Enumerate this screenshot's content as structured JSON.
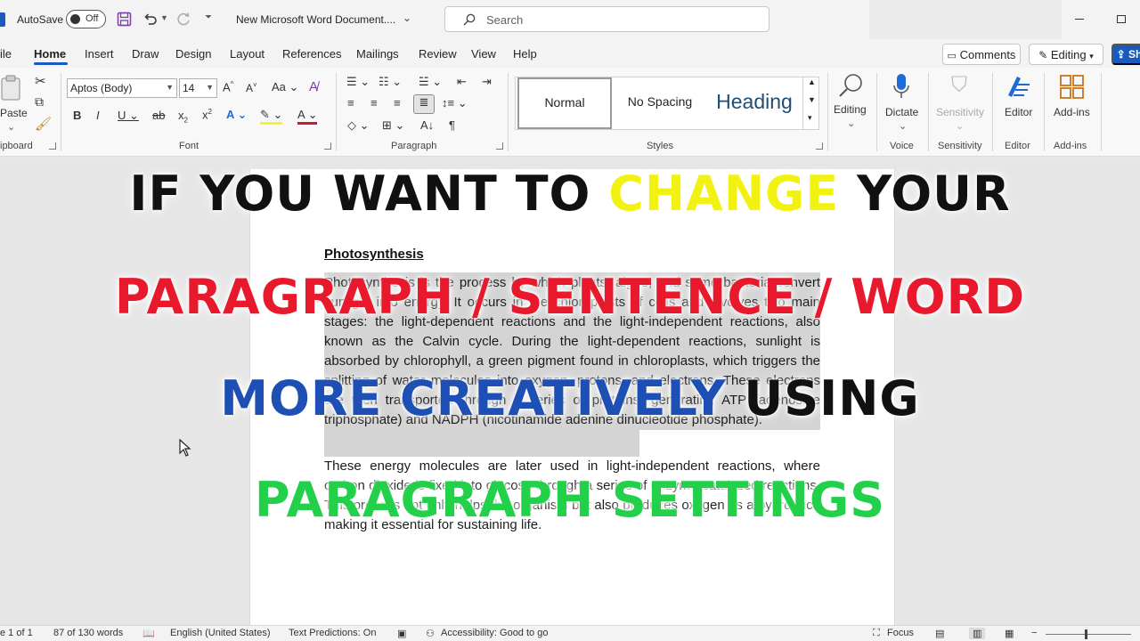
{
  "titlebar": {
    "autosave_label": "AutoSave",
    "autosave_state": "Off",
    "doc_name": "New Microsoft Word Document....",
    "search_placeholder": "Search"
  },
  "tabs": [
    {
      "label": "File",
      "display": "ile"
    },
    {
      "label": "Home",
      "active": true
    },
    {
      "label": "Insert"
    },
    {
      "label": "Draw"
    },
    {
      "label": "Design"
    },
    {
      "label": "Layout"
    },
    {
      "label": "References"
    },
    {
      "label": "Mailings"
    },
    {
      "label": "Review"
    },
    {
      "label": "View"
    },
    {
      "label": "Help"
    }
  ],
  "top_buttons": {
    "comments": "Comments",
    "editing": "Editing",
    "share": "Sh"
  },
  "ribbon": {
    "clipboard": {
      "paste": "Paste",
      "group_label": "ipboard"
    },
    "font": {
      "name": "Aptos (Body)",
      "size": "14",
      "group_label": "Font"
    },
    "paragraph": {
      "group_label": "Paragraph"
    },
    "styles": {
      "items": [
        "Normal",
        "No Spacing",
        "Heading"
      ],
      "group_label": "Styles"
    },
    "editing": {
      "label": "Editing"
    },
    "voice": {
      "dictate": "Dictate",
      "group_label": "Voice"
    },
    "sensitivity": {
      "label": "Sensitivity",
      "group_label": "Sensitivity"
    },
    "editor": {
      "label": "Editor",
      "group_label": "Editor"
    },
    "addins": {
      "label": "Add-ins",
      "group_label": "Add-ins"
    }
  },
  "document": {
    "title": "Photosynthesis",
    "paragraph1": "Photosynthesis is the process by which plants, algae, and some bacteria convert sunlight into energy. It occurs in the chloroplasts of cells and involves two main stages: the light-dependent reactions and the light-independent reactions, also known as the Calvin cycle. During the light-dependent reactions, sunlight is absorbed by chlorophyll, a green pigment found in chloroplasts, which triggers the splitting of water molecules into oxygen, protons, and electrons. These electrons are then transported through a series of proteins, generating ATP (adenosine triphosphate) and NADPH (nicotinamide adenine dinucleotide phosphate).",
    "paragraph2": "These energy molecules are later used in light-independent reactions, where carbon dioxide is fixed into glucose through a series of enzyme-catalyzed reactions. This process not only helps the organism but also produces oxygen as a byproduct, making it essential for sustaining life."
  },
  "overlay": {
    "line1": [
      {
        "text": "IF YOU WANT TO ",
        "color": "black"
      },
      {
        "text": "CHANGE",
        "color": "yellow"
      },
      {
        "text": " YOUR",
        "color": "black"
      }
    ],
    "line2": [
      {
        "text": "PARAGRAPH / SENTENCE / WORD",
        "color": "red"
      }
    ],
    "line3": [
      {
        "text": "MORE CREATIVELY ",
        "color": "blue"
      },
      {
        "text": "USING",
        "color": "black"
      }
    ],
    "line4": [
      {
        "text": "PARAGRAPH SETTINGS",
        "color": "green"
      }
    ]
  },
  "statusbar": {
    "page": "e 1 of 1",
    "words": "87 of 130 words",
    "language": "English (United States)",
    "predictions": "Text Predictions: On",
    "accessibility": "Accessibility: Good to go",
    "focus": "Focus"
  },
  "colors": {
    "accent": "#185abd",
    "highlight": "#d4d4d4"
  }
}
